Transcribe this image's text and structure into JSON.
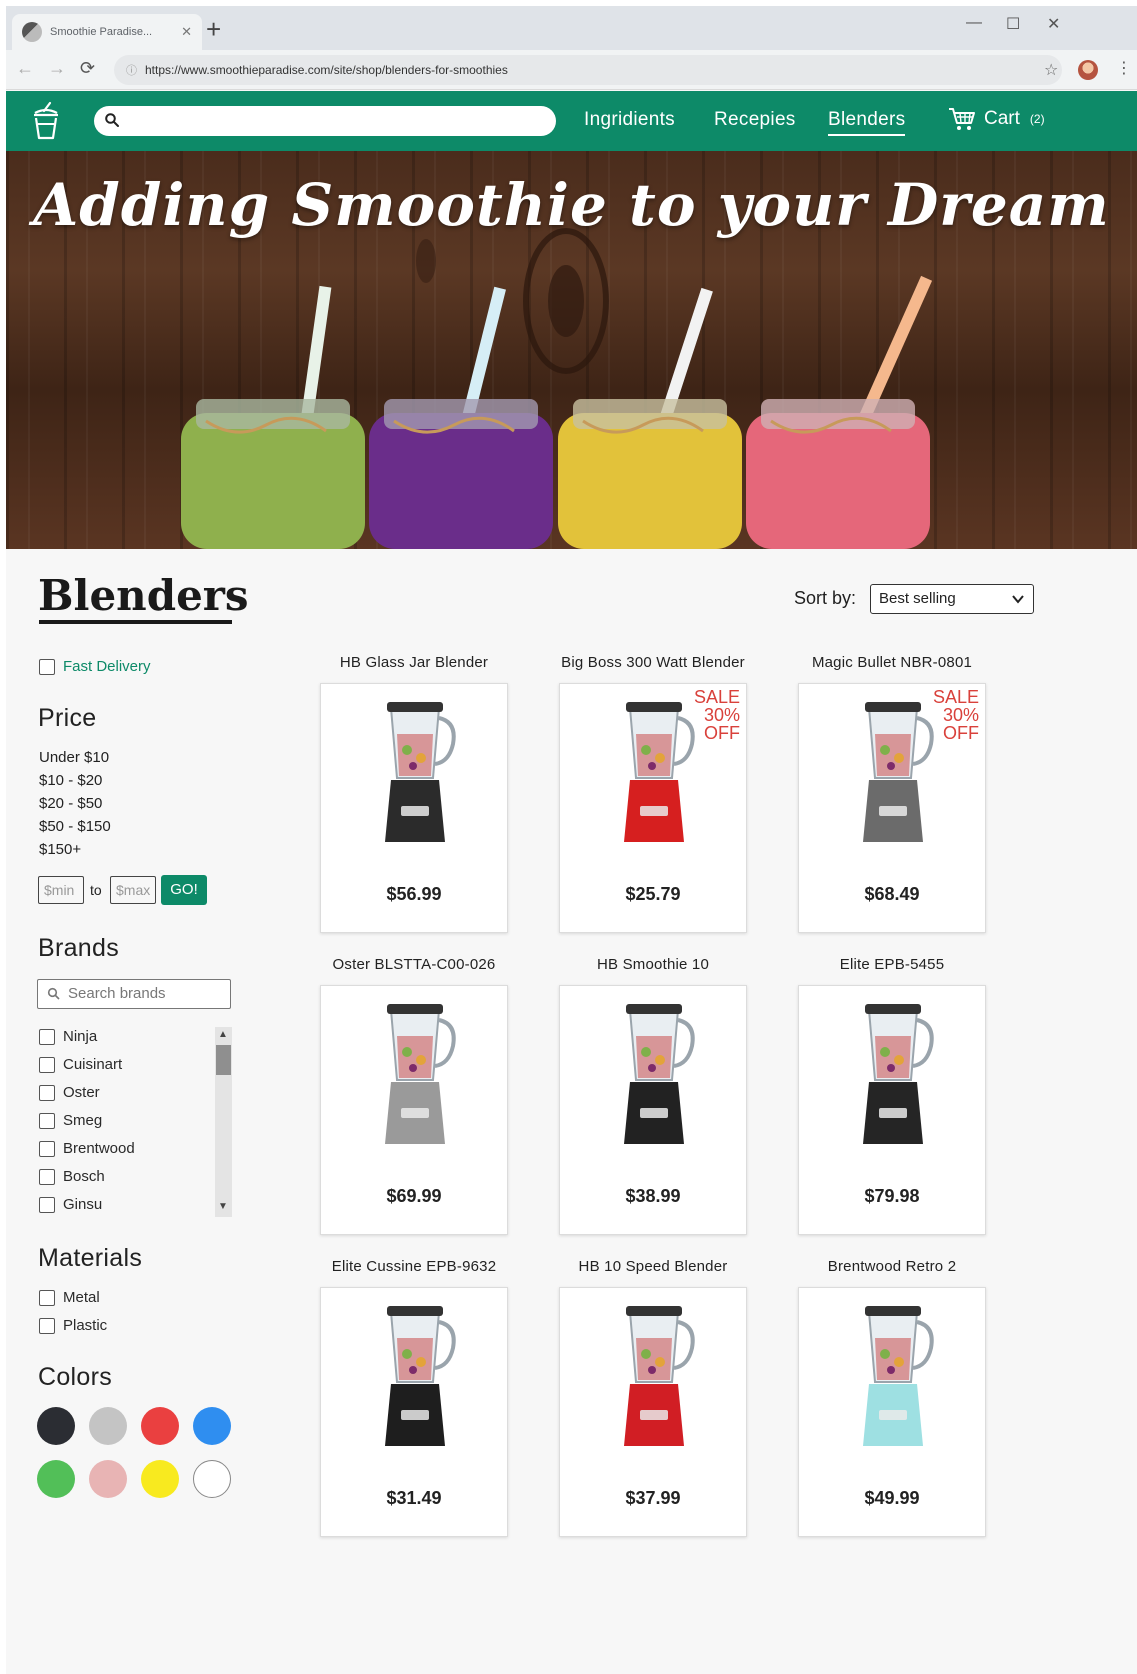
{
  "browser": {
    "tab_title": "Smoothie Paradise...",
    "url": "https://www.smoothieparadise.com/site/shop/blenders-for-smoothies"
  },
  "nav": {
    "links": [
      "Ingridients",
      "Recepies",
      "Blenders"
    ],
    "active": "Blenders",
    "cart_label": "Cart",
    "cart_count": "(2)"
  },
  "hero": {
    "title": "Adding Smoothie to your Dream"
  },
  "page": {
    "title": "Blenders",
    "sort_label": "Sort by:",
    "sort_value": "Best selling"
  },
  "filters": {
    "fast_delivery": "Fast Delivery",
    "price": {
      "heading": "Price",
      "ranges": [
        "Under $10",
        "$10 - $20",
        "$20 - $50",
        "$50 - $150",
        "$150+"
      ],
      "min_placeholder": "$min",
      "to": "to",
      "max_placeholder": "$max",
      "go": "GO!"
    },
    "brands": {
      "heading": "Brands",
      "search_placeholder": "Search brands",
      "items": [
        "Ninja",
        "Cuisinart",
        "Oster",
        "Smeg",
        "Brentwood",
        "Bosch",
        "Ginsu"
      ]
    },
    "materials": {
      "heading": "Materials",
      "items": [
        "Metal",
        "Plastic"
      ]
    },
    "colors": {
      "heading": "Colors",
      "swatches": [
        "#2b2d33",
        "#c4c4c4",
        "#ea4040",
        "#2f8ef0",
        "#52bf58",
        "#e8b4b4",
        "#f8ea1f",
        "#ffffff"
      ]
    }
  },
  "products": [
    {
      "name": "HB Glass Jar Blender",
      "price": "$56.99",
      "sale": "",
      "color": "#2b2b2b"
    },
    {
      "name": "Big Boss 300 Watt Blender",
      "price": "$25.79",
      "sale": "SALE 30% OFF",
      "color": "#d61f1f"
    },
    {
      "name": "Magic Bullet NBR-0801",
      "price": "$68.49",
      "sale": "SALE 30% OFF",
      "color": "#6b6b6b"
    },
    {
      "name": "Oster BLSTTA-C00-026",
      "price": "$69.99",
      "sale": "",
      "color": "#9a9a9a"
    },
    {
      "name": "HB Smoothie 10",
      "price": "$38.99",
      "sale": "",
      "color": "#222222"
    },
    {
      "name": "Elite EPB-5455",
      "price": "$79.98",
      "sale": "",
      "color": "#252525"
    },
    {
      "name": "Elite Cussine EPB-9632",
      "price": "$31.49",
      "sale": "",
      "color": "#1e1e1e"
    },
    {
      "name": "HB 10 Speed Blender",
      "price": "$37.99",
      "sale": "",
      "color": "#d11e24"
    },
    {
      "name": "Brentwood Retro 2",
      "price": "$49.99",
      "sale": "",
      "color": "#9ee0e2"
    }
  ]
}
